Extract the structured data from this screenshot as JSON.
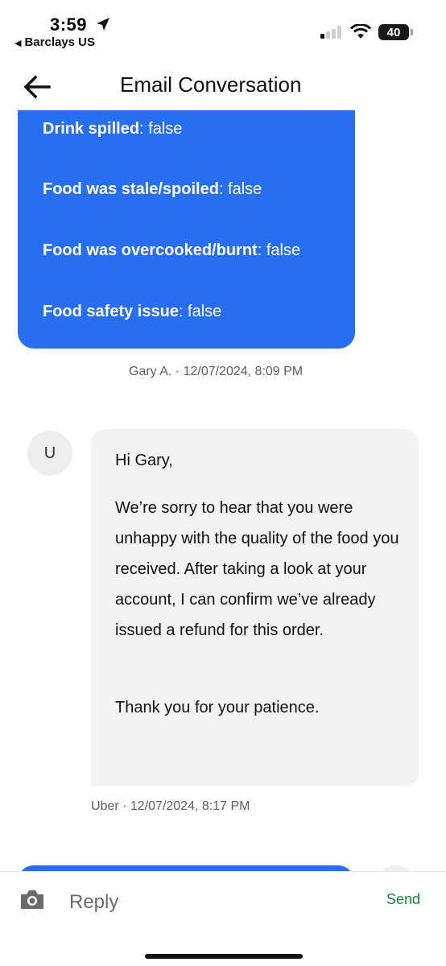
{
  "status_bar": {
    "time": "3:59",
    "back_app": "Barclays US",
    "battery": "40"
  },
  "header": {
    "title": "Email Conversation"
  },
  "messages": {
    "sent": {
      "fields": [
        {
          "label": "Drink spilled",
          "value": ": false"
        },
        {
          "label": "Food was stale/spoiled",
          "value": ": false"
        },
        {
          "label": "Food was overcooked/burnt",
          "value": ": false"
        },
        {
          "label": "Food safety issue",
          "value": ": false"
        }
      ],
      "meta": "Gary A. · 12/07/2024, 8:09 PM"
    },
    "received": {
      "avatar": "U",
      "greeting": "Hi Gary,",
      "body": "We’re sorry to hear that you were unhappy with the quality of the food you received. After taking a look at your account, I can confirm we’ve already issued a refund for this order.",
      "closing": "Thank you for your patience.",
      "meta": "Uber · 12/07/2024, 8:17 PM"
    }
  },
  "reply_bar": {
    "placeholder": "Reply",
    "send_label": "Send"
  },
  "colors": {
    "accent_blue": "#276ef1",
    "send_green": "#178a3a",
    "received_bg": "#f3f3f3"
  },
  "icons": [
    "location-arrow-icon",
    "signal-icon",
    "wifi-icon",
    "battery-icon",
    "back-arrow-icon",
    "camera-icon"
  ]
}
